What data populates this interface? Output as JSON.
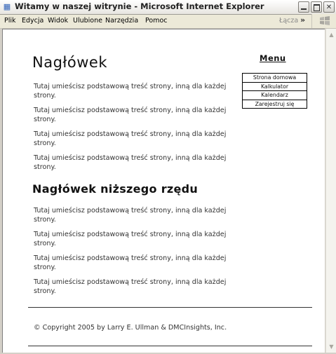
{
  "window": {
    "title": "Witamy w naszej witrynie - Microsoft Internet Explorer",
    "icon": "ie-page-icon",
    "controls": {
      "minimize": "minimize-icon",
      "maximize": "maximize-icon",
      "close": "close-icon"
    }
  },
  "menubar": {
    "items": [
      "Plik",
      "Edycja",
      "Widok",
      "Ulubione",
      "Narzędzia",
      "Pomoc"
    ],
    "links_label": "Łącza",
    "links_chevron": "»"
  },
  "page": {
    "heading": "Nagłówek",
    "subheading": "Nagłówek niższego rzędu",
    "paragraphs_top": [
      "Tutaj umieścisz podstawową treść strony, inną dla każdej strony.",
      "Tutaj umieścisz podstawową treść strony, inną dla każdej strony.",
      "Tutaj umieścisz podstawową treść strony, inną dla każdej strony.",
      "Tutaj umieścisz podstawową treść strony, inną dla każdej strony."
    ],
    "paragraphs_bottom": [
      "Tutaj umieścisz podstawową treść strony, inną dla każdej strony.",
      "Tutaj umieścisz podstawową treść strony, inną dla każdej strony.",
      "Tutaj umieścisz podstawową treść strony, inną dla każdej strony.",
      "Tutaj umieścisz podstawową treść strony, inną dla każdej strony."
    ],
    "menu": {
      "title": "Menu",
      "links": [
        "Strona domowa",
        "Kalkulator",
        "Kalendarz",
        "Zarejestruj się"
      ]
    },
    "footer": "© Copyright 2005 by Larry E. Ullman & DMCInsights, Inc."
  }
}
